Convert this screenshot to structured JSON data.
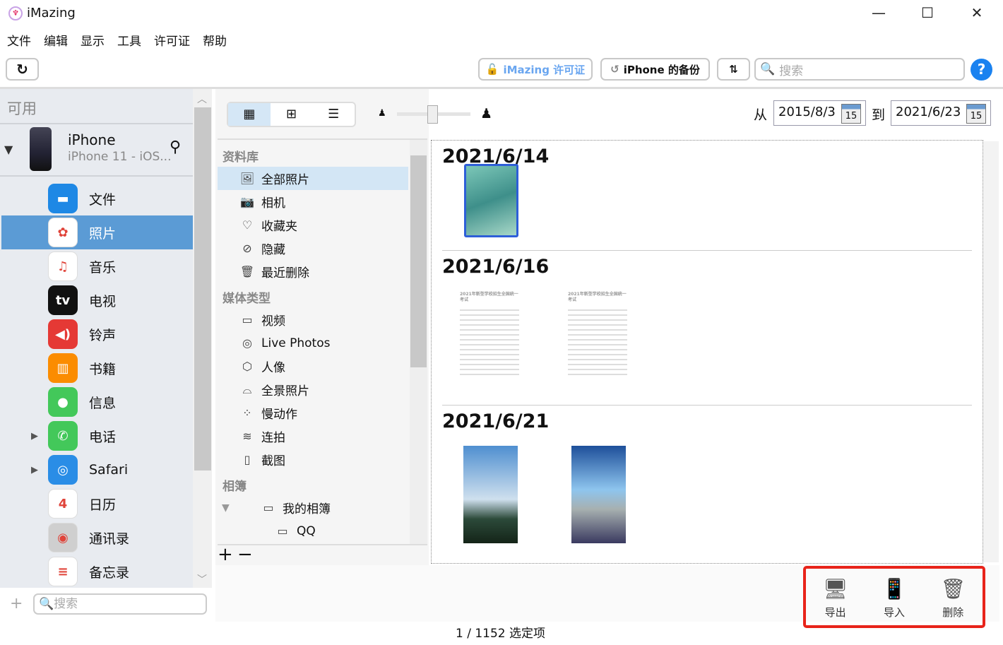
{
  "window": {
    "title": "iMazing",
    "minimize": "—",
    "maximize": "☐",
    "close": "✕"
  },
  "menu": [
    "文件",
    "编辑",
    "显示",
    "工具",
    "许可证",
    "帮助"
  ],
  "toolbar": {
    "license": "iMazing 许可证",
    "backup": "iPhone 的备份",
    "search_placeholder": "搜索",
    "help": "?"
  },
  "sidebar": {
    "section": "可用",
    "device": {
      "name": "iPhone",
      "model": "iPhone 11 - iOS..."
    },
    "items": [
      {
        "label": "文件",
        "color": "#1e88e5",
        "glyph": "▬"
      },
      {
        "label": "照片",
        "color": "#ffffff",
        "glyph": "✿",
        "selected": true
      },
      {
        "label": "音乐",
        "color": "#ffffff",
        "glyph": "♫"
      },
      {
        "label": "电视",
        "color": "#111111",
        "glyph": "tv"
      },
      {
        "label": "铃声",
        "color": "#e53935",
        "glyph": "◀)"
      },
      {
        "label": "书籍",
        "color": "#fb8c00",
        "glyph": "▥"
      },
      {
        "label": "信息",
        "color": "#43c85a",
        "glyph": "●"
      },
      {
        "label": "电话",
        "color": "#43c85a",
        "glyph": "✆"
      },
      {
        "label": "Safari",
        "color": "#2a8de6",
        "glyph": "◎"
      },
      {
        "label": "日历",
        "color": "#ffffff",
        "glyph": "4"
      },
      {
        "label": "通讯录",
        "color": "#cfcfcf",
        "glyph": "◉"
      },
      {
        "label": "备忘录",
        "color": "#ffffff",
        "glyph": "≡"
      }
    ],
    "search_placeholder": "搜索",
    "add": "+"
  },
  "filter": {
    "from_label": "从",
    "from": "2015/8/3",
    "to_label": "到",
    "to": "2021/6/23",
    "cal": "15"
  },
  "library": {
    "sections": [
      {
        "title": "资料库",
        "items": [
          {
            "label": "全部照片",
            "icon": "🖼",
            "selected": true
          },
          {
            "label": "相机",
            "icon": "📷"
          },
          {
            "label": "收藏夹",
            "icon": "♡"
          },
          {
            "label": "隐藏",
            "icon": "⊘"
          },
          {
            "label": "最近删除",
            "icon": "🗑"
          }
        ]
      },
      {
        "title": "媒体类型",
        "items": [
          {
            "label": "视频",
            "icon": "▭"
          },
          {
            "label": "Live Photos",
            "icon": "◎"
          },
          {
            "label": "人像",
            "icon": "⬡"
          },
          {
            "label": "全景照片",
            "icon": "⌓"
          },
          {
            "label": "慢动作",
            "icon": "⁘"
          },
          {
            "label": "连拍",
            "icon": "≋"
          },
          {
            "label": "截图",
            "icon": "▯"
          }
        ]
      },
      {
        "title": "相簿",
        "items": [
          {
            "label": "我的相簿",
            "icon": "▭"
          },
          {
            "label": "QQ",
            "icon": "▭"
          }
        ]
      }
    ],
    "add": "+",
    "remove": "−"
  },
  "groups": [
    {
      "date": "2021/6/14"
    },
    {
      "date": "2021/6/16",
      "doc_title": "2021年新型学校招生全国统一考试"
    },
    {
      "date": "2021/6/21"
    }
  ],
  "actions": {
    "export": "导出",
    "import": "导入",
    "delete": "删除",
    "highlight": "#e8231a"
  },
  "status": "1 / 1152 选定项"
}
